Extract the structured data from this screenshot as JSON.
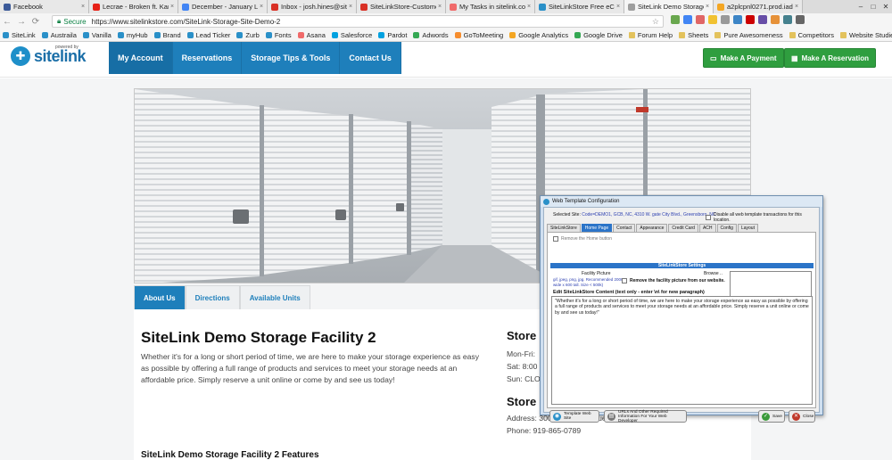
{
  "browser": {
    "tabs": [
      {
        "label": "Facebook",
        "color": "#3b5998"
      },
      {
        "label": "Lecrae - Broken ft. Kari",
        "color": "#e62117"
      },
      {
        "label": "December - January Lea",
        "color": "#4285f4"
      },
      {
        "label": "Inbox - josh.hines@sitel",
        "color": "#d93025"
      },
      {
        "label": "SiteLinkStore-Customer",
        "color": "#d93025"
      },
      {
        "label": "My Tasks in sitelink.co",
        "color": "#f06a6a"
      },
      {
        "label": "SiteLinkStore Free eCom",
        "color": "#2a90c8"
      },
      {
        "label": "SiteLink Demo Storage",
        "color": "#9e9e9e"
      },
      {
        "label": "a2plcpnl0271.prod.iad2.",
        "color": "#f4a623"
      }
    ],
    "address": {
      "secure_label": "Secure",
      "url": "https://www.sitelinkstore.com/SiteLink-Storage-Site-Demo-2"
    },
    "bookmarks": [
      {
        "label": "SiteLink",
        "color": "#2a90c8"
      },
      {
        "label": "Austraila",
        "color": "#2a90c8"
      },
      {
        "label": "Vanilla",
        "color": "#2a90c8"
      },
      {
        "label": "myHub",
        "color": "#2a90c8"
      },
      {
        "label": "Brand",
        "color": "#2a90c8"
      },
      {
        "label": "Lead Ticker",
        "color": "#2a90c8"
      },
      {
        "label": "Zurb",
        "color": "#2a90c8"
      },
      {
        "label": "Fonts",
        "color": "#2a90c8"
      },
      {
        "label": "Asana",
        "color": "#f06a6a"
      },
      {
        "label": "Salesforce",
        "color": "#00a1e0"
      },
      {
        "label": "Pardot",
        "color": "#00a1e0"
      },
      {
        "label": "Adwords",
        "color": "#34a853"
      },
      {
        "label": "GoToMeeting",
        "color": "#f68d2e"
      },
      {
        "label": "Google Analytics",
        "color": "#f4a623"
      },
      {
        "label": "Google Drive",
        "color": "#34a853"
      },
      {
        "label": "Forum Help",
        "color": "folder"
      },
      {
        "label": "Sheets",
        "color": "folder"
      },
      {
        "label": "Pure Awesomeness",
        "color": "folder"
      },
      {
        "label": "Competitors",
        "color": "folder"
      },
      {
        "label": "Website Studies",
        "color": "folder"
      },
      {
        "label": "Studies",
        "color": "folder"
      },
      {
        "label": "Imported",
        "color": "folder"
      }
    ]
  },
  "site": {
    "logo": {
      "powered": "powered by",
      "word": "sitelink"
    },
    "nav": [
      "My Account",
      "Reservations",
      "Storage Tips & Tools",
      "Contact Us"
    ],
    "payment_button": "Make A Payment",
    "reservation_button": "Make A Reservation",
    "accent": "#1e7fbb",
    "green": "#2f9e3f"
  },
  "page": {
    "tabs": [
      "About Us",
      "Directions",
      "Available Units"
    ],
    "title": "SiteLink Demo Storage Facility 2",
    "description": "Whether it's for a long or short period of time, we are here to make your storage experience as easy as possible by offering a full range of products and services to meet your storage needs at an affordable price. Simply reserve a unit online or come by and see us today!",
    "features_heading": "SiteLink Demo Storage Facility 2 Features",
    "side": {
      "hours_heading": "Store",
      "hours": [
        "Mon-Fri:",
        "Sat: 8:00",
        "Sun: CLO"
      ],
      "info_heading": "Store",
      "address": "Address: 300 Atlantic Avenue, Raleigh, NC 27604",
      "phone": "Phone: 919-865-0789"
    }
  },
  "dialog": {
    "title": "Web Template Configuration",
    "selected_label": "Selected  Site:",
    "selected_value": "Code=DEMO1,   GCB, NC, 4310 W. gate City Blvd., Greensboro, NC",
    "disable_label": "Disable all web template transactions for this location.",
    "tabs": [
      "SiteLinkStore",
      "Home Page",
      "Contact",
      "Appearance",
      "Credit Card",
      "ACH",
      "Config",
      "Layout"
    ],
    "remove_home": "Remove the Home button",
    "settings_header": "SiteLinkStore Settings",
    "facility_picture": "Facility Picture",
    "browse": "Browse ..",
    "picture_note": "gif, jpeg, png, jpg. Recommended 2000 wide x 600 tall. Size < 500k)",
    "remove_picture": "Remove the facility picture from our website.",
    "edit_label": "Edit SiteLinkStore Content (text only - enter \\n\\ for new paragraph)",
    "content_text": "\"Whether it's for a long or short period of time, we are here to make your storage experience as easy as possible by offering a full range of products and services to meet your storage needs at an affordable price. Simply reserve a unit online or come by and see us today!\"",
    "btn_template": "Template Web Site",
    "btn_urls": "URLs And Other Required Information For Your Web Developer",
    "btn_save": "Save",
    "btn_close": "Close"
  }
}
